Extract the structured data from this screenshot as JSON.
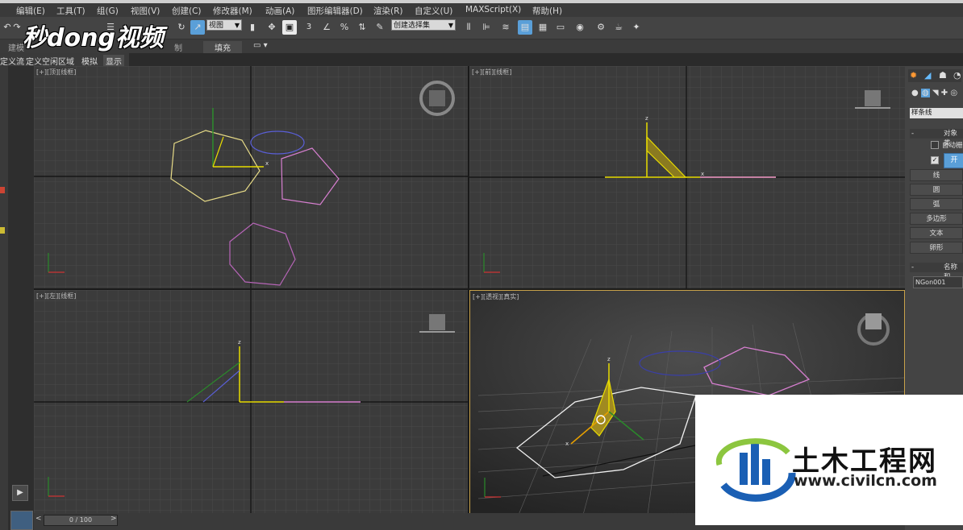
{
  "menu": {
    "items": [
      "编辑(E)",
      "工具(T)",
      "组(G)",
      "视图(V)",
      "创建(C)",
      "修改器(M)",
      "动画(A)",
      "图形编辑器(D)",
      "渲染(R)",
      "自定义(U)",
      "MAXScript(X)",
      "帮助(H)"
    ]
  },
  "toolbar": {
    "view_select": "视图",
    "selection_set": "创建选择集",
    "snap_label": "3",
    "percent_label": "%"
  },
  "ribbon": {
    "tab_model": "建模",
    "tab_paint": "制",
    "fill_button": "填充"
  },
  "subbar": {
    "flow": "定义流",
    "space": "定义空闲区域",
    "simulate": "模拟",
    "display": "显示"
  },
  "viewports": {
    "top_label": "[+][顶][线框]",
    "front_label": "[+][前][线框]",
    "left_label": "[+][左][线框]",
    "persp_label": "[+][透视][真实]"
  },
  "axis": {
    "x": "x",
    "z": "z"
  },
  "right_panel": {
    "category": "样条线",
    "rollout_object": "对象类",
    "auto_grid": "自动栅",
    "start_btn": "开",
    "buttons": [
      "线",
      "圆",
      "弧",
      "多边形",
      "文本",
      "卵形"
    ],
    "rollout_name": "名称和",
    "name_value": "NGon001"
  },
  "timeline": {
    "frame": "0 / 100"
  },
  "watermark": {
    "brand": "秒dong视频",
    "civil_title": "土木工程网",
    "civil_url": "www.civilcn.com"
  },
  "colors": {
    "accent": "#5a9fd8",
    "active_viewport_border": "#c8a24a",
    "shape_yellow": "#e8dc88",
    "shape_pink": "#d77fd0",
    "shape_blue": "#5a5fd8"
  }
}
